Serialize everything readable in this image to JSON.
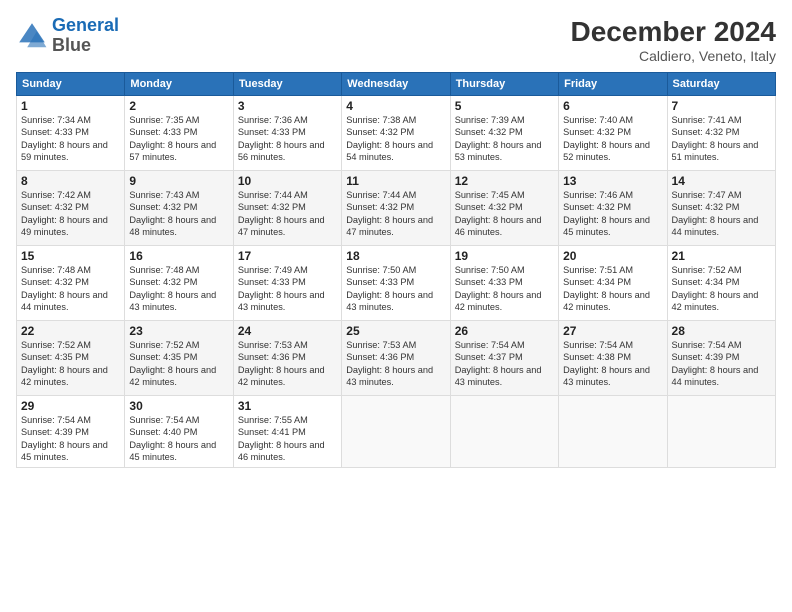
{
  "header": {
    "logo_line1": "General",
    "logo_line2": "Blue",
    "title": "December 2024",
    "location": "Caldiero, Veneto, Italy"
  },
  "weekdays": [
    "Sunday",
    "Monday",
    "Tuesday",
    "Wednesday",
    "Thursday",
    "Friday",
    "Saturday"
  ],
  "weeks": [
    [
      {
        "day": "1",
        "sunrise": "Sunrise: 7:34 AM",
        "sunset": "Sunset: 4:33 PM",
        "daylight": "Daylight: 8 hours and 59 minutes."
      },
      {
        "day": "2",
        "sunrise": "Sunrise: 7:35 AM",
        "sunset": "Sunset: 4:33 PM",
        "daylight": "Daylight: 8 hours and 57 minutes."
      },
      {
        "day": "3",
        "sunrise": "Sunrise: 7:36 AM",
        "sunset": "Sunset: 4:33 PM",
        "daylight": "Daylight: 8 hours and 56 minutes."
      },
      {
        "day": "4",
        "sunrise": "Sunrise: 7:38 AM",
        "sunset": "Sunset: 4:32 PM",
        "daylight": "Daylight: 8 hours and 54 minutes."
      },
      {
        "day": "5",
        "sunrise": "Sunrise: 7:39 AM",
        "sunset": "Sunset: 4:32 PM",
        "daylight": "Daylight: 8 hours and 53 minutes."
      },
      {
        "day": "6",
        "sunrise": "Sunrise: 7:40 AM",
        "sunset": "Sunset: 4:32 PM",
        "daylight": "Daylight: 8 hours and 52 minutes."
      },
      {
        "day": "7",
        "sunrise": "Sunrise: 7:41 AM",
        "sunset": "Sunset: 4:32 PM",
        "daylight": "Daylight: 8 hours and 51 minutes."
      }
    ],
    [
      {
        "day": "8",
        "sunrise": "Sunrise: 7:42 AM",
        "sunset": "Sunset: 4:32 PM",
        "daylight": "Daylight: 8 hours and 49 minutes."
      },
      {
        "day": "9",
        "sunrise": "Sunrise: 7:43 AM",
        "sunset": "Sunset: 4:32 PM",
        "daylight": "Daylight: 8 hours and 48 minutes."
      },
      {
        "day": "10",
        "sunrise": "Sunrise: 7:44 AM",
        "sunset": "Sunset: 4:32 PM",
        "daylight": "Daylight: 8 hours and 47 minutes."
      },
      {
        "day": "11",
        "sunrise": "Sunrise: 7:44 AM",
        "sunset": "Sunset: 4:32 PM",
        "daylight": "Daylight: 8 hours and 47 minutes."
      },
      {
        "day": "12",
        "sunrise": "Sunrise: 7:45 AM",
        "sunset": "Sunset: 4:32 PM",
        "daylight": "Daylight: 8 hours and 46 minutes."
      },
      {
        "day": "13",
        "sunrise": "Sunrise: 7:46 AM",
        "sunset": "Sunset: 4:32 PM",
        "daylight": "Daylight: 8 hours and 45 minutes."
      },
      {
        "day": "14",
        "sunrise": "Sunrise: 7:47 AM",
        "sunset": "Sunset: 4:32 PM",
        "daylight": "Daylight: 8 hours and 44 minutes."
      }
    ],
    [
      {
        "day": "15",
        "sunrise": "Sunrise: 7:48 AM",
        "sunset": "Sunset: 4:32 PM",
        "daylight": "Daylight: 8 hours and 44 minutes."
      },
      {
        "day": "16",
        "sunrise": "Sunrise: 7:48 AM",
        "sunset": "Sunset: 4:32 PM",
        "daylight": "Daylight: 8 hours and 43 minutes."
      },
      {
        "day": "17",
        "sunrise": "Sunrise: 7:49 AM",
        "sunset": "Sunset: 4:33 PM",
        "daylight": "Daylight: 8 hours and 43 minutes."
      },
      {
        "day": "18",
        "sunrise": "Sunrise: 7:50 AM",
        "sunset": "Sunset: 4:33 PM",
        "daylight": "Daylight: 8 hours and 43 minutes."
      },
      {
        "day": "19",
        "sunrise": "Sunrise: 7:50 AM",
        "sunset": "Sunset: 4:33 PM",
        "daylight": "Daylight: 8 hours and 42 minutes."
      },
      {
        "day": "20",
        "sunrise": "Sunrise: 7:51 AM",
        "sunset": "Sunset: 4:34 PM",
        "daylight": "Daylight: 8 hours and 42 minutes."
      },
      {
        "day": "21",
        "sunrise": "Sunrise: 7:52 AM",
        "sunset": "Sunset: 4:34 PM",
        "daylight": "Daylight: 8 hours and 42 minutes."
      }
    ],
    [
      {
        "day": "22",
        "sunrise": "Sunrise: 7:52 AM",
        "sunset": "Sunset: 4:35 PM",
        "daylight": "Daylight: 8 hours and 42 minutes."
      },
      {
        "day": "23",
        "sunrise": "Sunrise: 7:52 AM",
        "sunset": "Sunset: 4:35 PM",
        "daylight": "Daylight: 8 hours and 42 minutes."
      },
      {
        "day": "24",
        "sunrise": "Sunrise: 7:53 AM",
        "sunset": "Sunset: 4:36 PM",
        "daylight": "Daylight: 8 hours and 42 minutes."
      },
      {
        "day": "25",
        "sunrise": "Sunrise: 7:53 AM",
        "sunset": "Sunset: 4:36 PM",
        "daylight": "Daylight: 8 hours and 43 minutes."
      },
      {
        "day": "26",
        "sunrise": "Sunrise: 7:54 AM",
        "sunset": "Sunset: 4:37 PM",
        "daylight": "Daylight: 8 hours and 43 minutes."
      },
      {
        "day": "27",
        "sunrise": "Sunrise: 7:54 AM",
        "sunset": "Sunset: 4:38 PM",
        "daylight": "Daylight: 8 hours and 43 minutes."
      },
      {
        "day": "28",
        "sunrise": "Sunrise: 7:54 AM",
        "sunset": "Sunset: 4:39 PM",
        "daylight": "Daylight: 8 hours and 44 minutes."
      }
    ],
    [
      {
        "day": "29",
        "sunrise": "Sunrise: 7:54 AM",
        "sunset": "Sunset: 4:39 PM",
        "daylight": "Daylight: 8 hours and 45 minutes."
      },
      {
        "day": "30",
        "sunrise": "Sunrise: 7:54 AM",
        "sunset": "Sunset: 4:40 PM",
        "daylight": "Daylight: 8 hours and 45 minutes."
      },
      {
        "day": "31",
        "sunrise": "Sunrise: 7:55 AM",
        "sunset": "Sunset: 4:41 PM",
        "daylight": "Daylight: 8 hours and 46 minutes."
      },
      null,
      null,
      null,
      null
    ]
  ]
}
